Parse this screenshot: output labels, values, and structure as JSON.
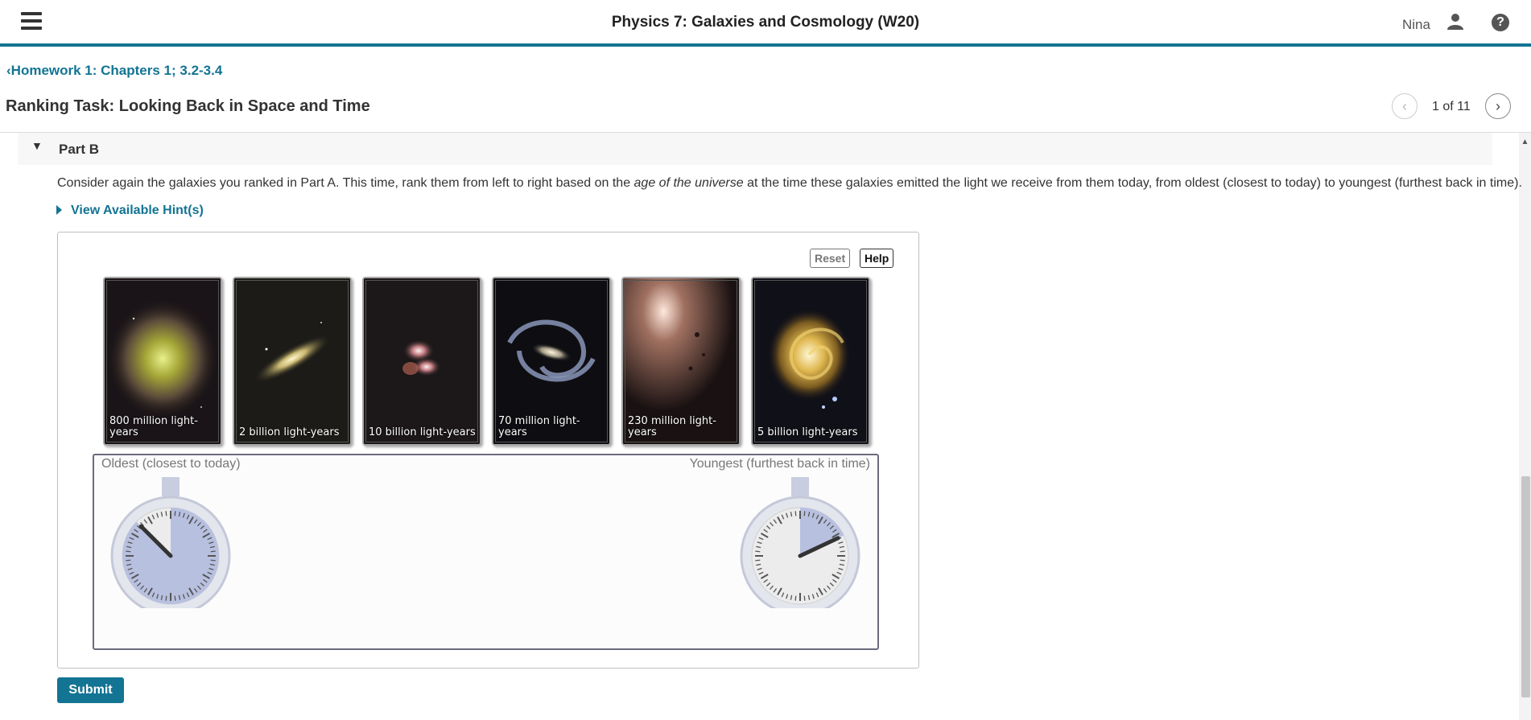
{
  "app": {
    "title": "Physics 7: Galaxies and Cosmology (W20)",
    "user_name": "Nina"
  },
  "breadcrumb": {
    "label": "Homework 1: Chapters 1; 3.2-3.4"
  },
  "page": {
    "title": "Ranking Task: Looking Back in Space and Time"
  },
  "pager": {
    "label": "1 of 11"
  },
  "part": {
    "title": "Part B"
  },
  "question": {
    "text_before": "Consider again the galaxies you ranked in Part A. This time, rank them from left to right based on the ",
    "text_emphasis": "age of the universe",
    "text_after": " at the time these galaxies emitted the light we receive from them today, from oldest (closest to today) to youngest (furthest back in time)."
  },
  "hints": {
    "label": "View Available Hint(s)"
  },
  "widget": {
    "reset_label": "Reset",
    "help_label": "Help",
    "cards": [
      {
        "label": "800 million light-years",
        "icon": "galaxy-image-elliptical"
      },
      {
        "label": "2 billion light-years",
        "icon": "galaxy-image-edge-on"
      },
      {
        "label": "10 billion light-years",
        "icon": "galaxy-image-irregular"
      },
      {
        "label": "70 million light-years",
        "icon": "galaxy-image-barred-spiral"
      },
      {
        "label": "230 million light-years",
        "icon": "galaxy-image-dusty"
      },
      {
        "label": "5 billion light-years",
        "icon": "galaxy-image-face-on-spiral"
      }
    ],
    "zone_left_label": "Oldest (closest to today)",
    "zone_right_label": "Youngest (furthest back in time)",
    "clocks": [
      {
        "name": "oldest-clock",
        "elapsed_fraction": 0.875
      },
      {
        "name": "youngest-clock",
        "elapsed_fraction": 0.18
      }
    ]
  },
  "submit": {
    "label": "Submit"
  },
  "colors": {
    "accent": "#137493",
    "clock_fill": "#b8c0e0"
  }
}
